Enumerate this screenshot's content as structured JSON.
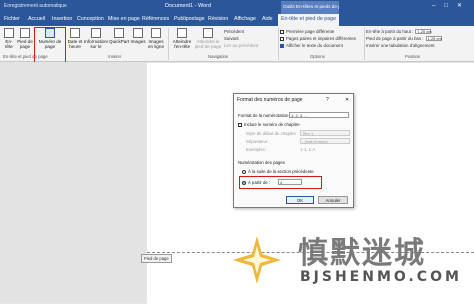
{
  "titlebar": {
    "autosave": "Enregistrement automatique",
    "doc_title": "Document1 - Word",
    "context_tab": "Outils En-têtes et pieds de page"
  },
  "tabs": [
    "Fichier",
    "Accueil",
    "Insertion",
    "Conception",
    "Mise en page",
    "Références",
    "Publipostage",
    "Révision",
    "Affichage",
    "Aide",
    "En-tête et pied de page"
  ],
  "ribbon": {
    "b_entete": "En-tête",
    "b_pied": "Pied de page",
    "b_num": "Numéro de page",
    "b_date": "Date et heure",
    "b_info": "Informations sur le document",
    "b_quick": "QuickPart",
    "b_img": "Images",
    "b_imgline": "Images en ligne",
    "b_goto_header": "Atteindre l'en-tête",
    "b_goto_footer": "Atteindre le pied de page",
    "nav_prev": "Précédent",
    "nav_next": "Suivant",
    "nav_link": "Lier au précédent",
    "opt1": "Première page différente",
    "opt2": "Pages paires et impaires différentes",
    "opt3": "Afficher le texte du document",
    "pos1": "En-tête à partir du haut :",
    "pos1_val": "1,25 cm",
    "pos2": "Pied de page à partir du bas :",
    "pos2_val": "1,25 cm",
    "pos3": "Insérer une tabulation d'alignement",
    "g1": "En-tête et pied de page",
    "g2": "Insérer",
    "g3": "Navigation",
    "g4": "Options",
    "g5": "Position"
  },
  "dialog": {
    "title": "Format des numéros de page",
    "help": "?",
    "close": "✕",
    "format_label": "Format de la numérotation :",
    "format_value": "1, 2, 3, ...",
    "chapter_label": "Inclure le numéro de chapitre",
    "style_label": "Style de début de chapitre :",
    "style_value": "Titre 1",
    "sep_label": "Séparateur :",
    "sep_value": "- (trait d'union)",
    "examples_label": "Exemples :",
    "examples_value": "1-1, 1-A",
    "numbering_label": "Numérotation des pages",
    "continue_label": "À la suite de la section précédente",
    "start_label": "À partir de :",
    "start_value": "4",
    "ok": "OK",
    "cancel": "Annuler"
  },
  "footer_tag": "Pied de page",
  "watermark": {
    "main": "慎默迷城",
    "sub": "BJSHENMO.COM"
  },
  "colors": {
    "accent": "#2b579a",
    "highlight": "#d11b1b"
  }
}
